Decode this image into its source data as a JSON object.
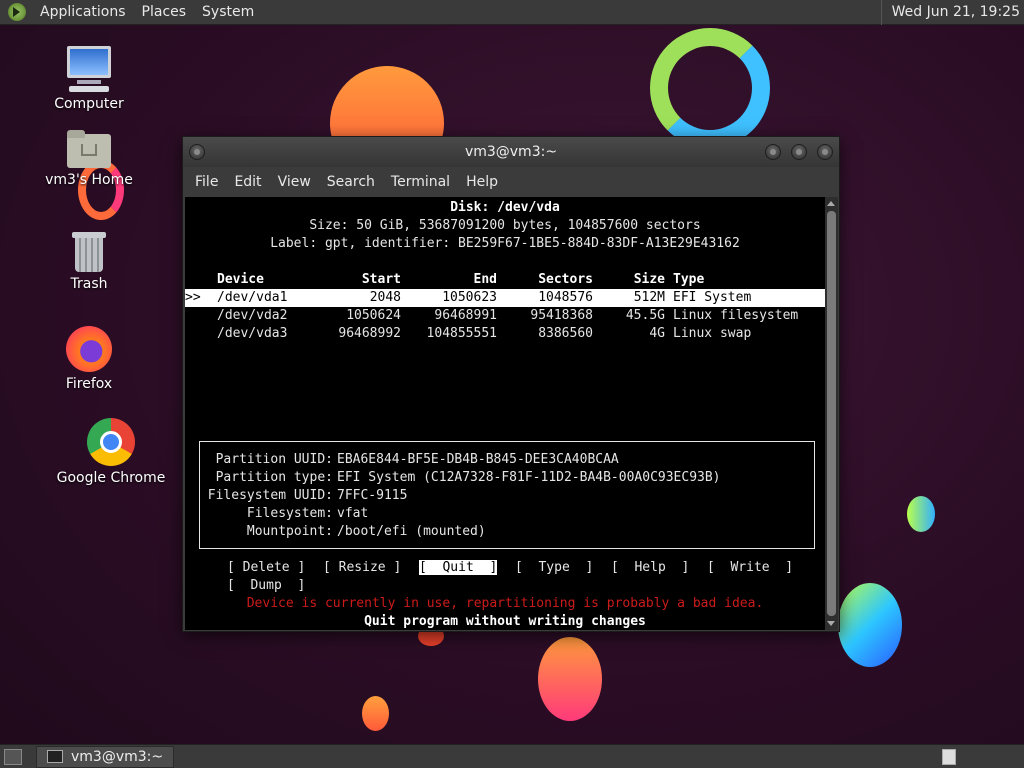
{
  "top_panel": {
    "menus": [
      "Applications",
      "Places",
      "System"
    ],
    "clock": "Wed Jun 21, 19:25"
  },
  "desktop_icons": {
    "computer": "Computer",
    "home": "vm3's Home",
    "trash": "Trash",
    "firefox": "Firefox",
    "chrome": "Google Chrome"
  },
  "window": {
    "title": "vm3@vm3:~",
    "menus": [
      "File",
      "Edit",
      "View",
      "Search",
      "Terminal",
      "Help"
    ]
  },
  "cfdisk": {
    "disk": "Disk: /dev/vda",
    "size": "Size: 50 GiB, 53687091200 bytes, 104857600 sectors",
    "label": "Label: gpt, identifier: BE259F67-1BE5-884D-83DF-A13E29E43162",
    "headers": {
      "device": "Device",
      "start": "Start",
      "end": "End",
      "sectors": "Sectors",
      "size": "Size",
      "type": "Type"
    },
    "cursor": ">>",
    "partitions": [
      {
        "device": "/dev/vda1",
        "start": "2048",
        "end": "1050623",
        "sectors": "1048576",
        "size": "512M",
        "type": "EFI System"
      },
      {
        "device": "/dev/vda2",
        "start": "1050624",
        "end": "96468991",
        "sectors": "95418368",
        "size": "45.5G",
        "type": "Linux filesystem"
      },
      {
        "device": "/dev/vda3",
        "start": "96468992",
        "end": "104855551",
        "sectors": "8386560",
        "size": "4G",
        "type": "Linux swap"
      }
    ],
    "info": {
      "part_uuid_label": "Partition UUID:",
      "part_uuid": "EBA6E844-BF5E-DB4B-B845-DEE3CA40BCAA",
      "part_type_label": "Partition type:",
      "part_type": "EFI System (C12A7328-F81F-11D2-BA4B-00A0C93EC93B)",
      "fs_uuid_label": "Filesystem UUID:",
      "fs_uuid": "7FFC-9115",
      "fs_label": "Filesystem:",
      "fs": "vfat",
      "mount_label": "Mountpoint:",
      "mount": "/boot/efi (mounted)"
    },
    "buttons": {
      "delete": "Delete",
      "resize": "Resize",
      "quit": "Quit",
      "type": "Type",
      "help": "Help",
      "write": "Write",
      "dump": "Dump"
    },
    "warning": "Device is currently in use, repartitioning is probably a bad idea.",
    "hint": "Quit program without writing changes"
  },
  "taskbar": {
    "task": "vm3@vm3:~"
  }
}
